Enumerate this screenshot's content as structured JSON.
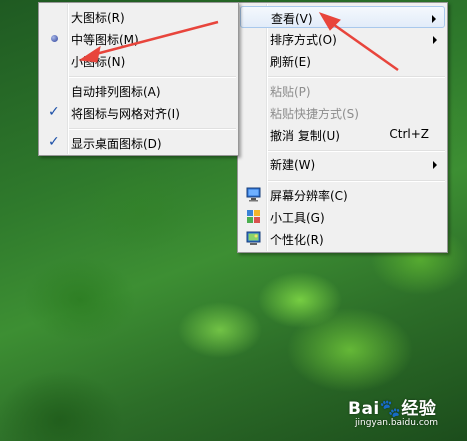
{
  "context_menu": {
    "items": [
      {
        "label": "查看(V)",
        "submenu": true
      },
      {
        "label": "排序方式(O)",
        "submenu": true
      },
      {
        "label": "刷新(E)"
      },
      {
        "label": "粘贴(P)",
        "disabled": true
      },
      {
        "label": "粘贴快捷方式(S)",
        "disabled": true
      },
      {
        "label": "撤消 复制(U)",
        "shortcut": "Ctrl+Z"
      },
      {
        "label": "新建(W)",
        "submenu": true
      },
      {
        "label": "屏幕分辨率(C)",
        "icon": "display-icon"
      },
      {
        "label": "小工具(G)",
        "icon": "gadgets-icon"
      },
      {
        "label": "个性化(R)",
        "icon": "personalize-icon"
      }
    ]
  },
  "view_submenu": {
    "items": [
      {
        "label": "大图标(R)"
      },
      {
        "label": "中等图标(M)",
        "selected": true
      },
      {
        "label": "小图标(N)"
      },
      {
        "label": "自动排列图标(A)"
      },
      {
        "label": "将图标与网格对齐(I)",
        "checked": true
      },
      {
        "label": "显示桌面图标(D)",
        "checked": true
      }
    ]
  },
  "glyphs": {
    "check": "✓"
  },
  "watermark": {
    "text": "Bai🐾经验",
    "sub": "jingyan.baidu.com"
  },
  "colors": {
    "highlight_border": "#a8c8ec",
    "annotation_arrow": "#e8453c",
    "menu_bg": "#f0f0f0"
  }
}
